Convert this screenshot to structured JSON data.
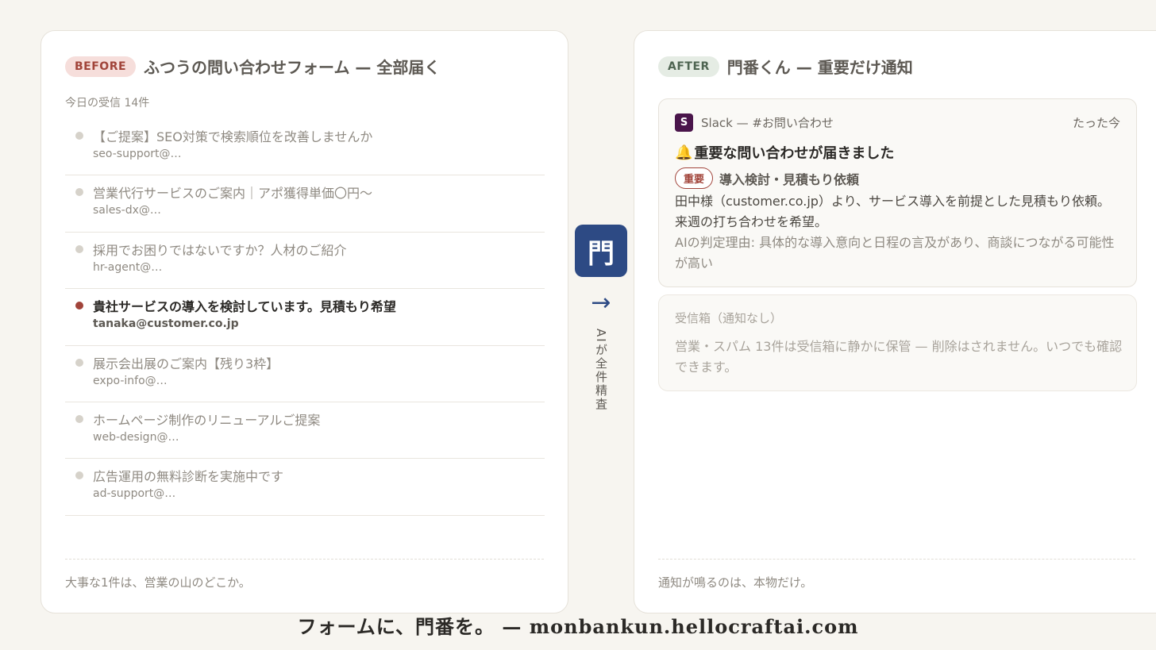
{
  "before": {
    "badge": "BEFORE",
    "title": "ふつうの問い合わせフォーム — 全部届く",
    "count_label": "今日の受信 14件",
    "mails": [
      {
        "subject": "【ご提案】SEO対策で検索順位を改善しませんか",
        "sender": "seo-support@…",
        "important": false
      },
      {
        "subject": "営業代行サービスのご案内｜アポ獲得単価〇円〜",
        "sender": "sales-dx@…",
        "important": false
      },
      {
        "subject": "採用でお困りではないですか？人材のご紹介",
        "sender": "hr-agent@…",
        "important": false
      },
      {
        "subject": "貴社サービスの導入を検討しています。見積もり希望",
        "sender": "tanaka@customer.co.jp",
        "important": true
      },
      {
        "subject": "展示会出展のご案内【残り3枠】",
        "sender": "expo-info@…",
        "important": false
      },
      {
        "subject": "ホームページ制作のリニューアルご提案",
        "sender": "web-design@…",
        "important": false
      },
      {
        "subject": "広告運用の無料診断を実施中です",
        "sender": "ad-support@…",
        "important": false
      }
    ],
    "footer": "大事な1件は、営業の山のどこか。"
  },
  "flow": {
    "gate_glyph": "門",
    "arrow": "→",
    "label": "AIが全件精査"
  },
  "after": {
    "badge": "AFTER",
    "title": "門番くん — 重要だけ通知",
    "slack": {
      "logo": "S",
      "channel": "Slack — #お問い合わせ",
      "time": "たった今",
      "bell": "🔔",
      "title": "重要な問い合わせが届きました",
      "tag": "重要",
      "subject": "導入検討・見積もり依頼",
      "body": "田中様（customer.co.jp）より、サービス導入を前提とした見積もり依頼。来週の打ち合わせを希望。",
      "reason": "AIの判定理由: 具体的な導入意向と日程の言及があり、商談につながる可能性が高い"
    },
    "inbox": {
      "title": "受信箱（通知なし）",
      "body": "営業・スパム 13件は受信箱に静かに保管 — 削除はされません。いつでも確認できます。"
    },
    "footer": "通知が鳴るのは、本物だけ。"
  },
  "tagline": "フォームに、門番を。 — monbankun.hellocraftai.com",
  "colors": {
    "accent_red": "#a1443a",
    "accent_navy": "#2d4a84",
    "slack_purple": "#4a154b",
    "background": "#f7f5f0"
  }
}
